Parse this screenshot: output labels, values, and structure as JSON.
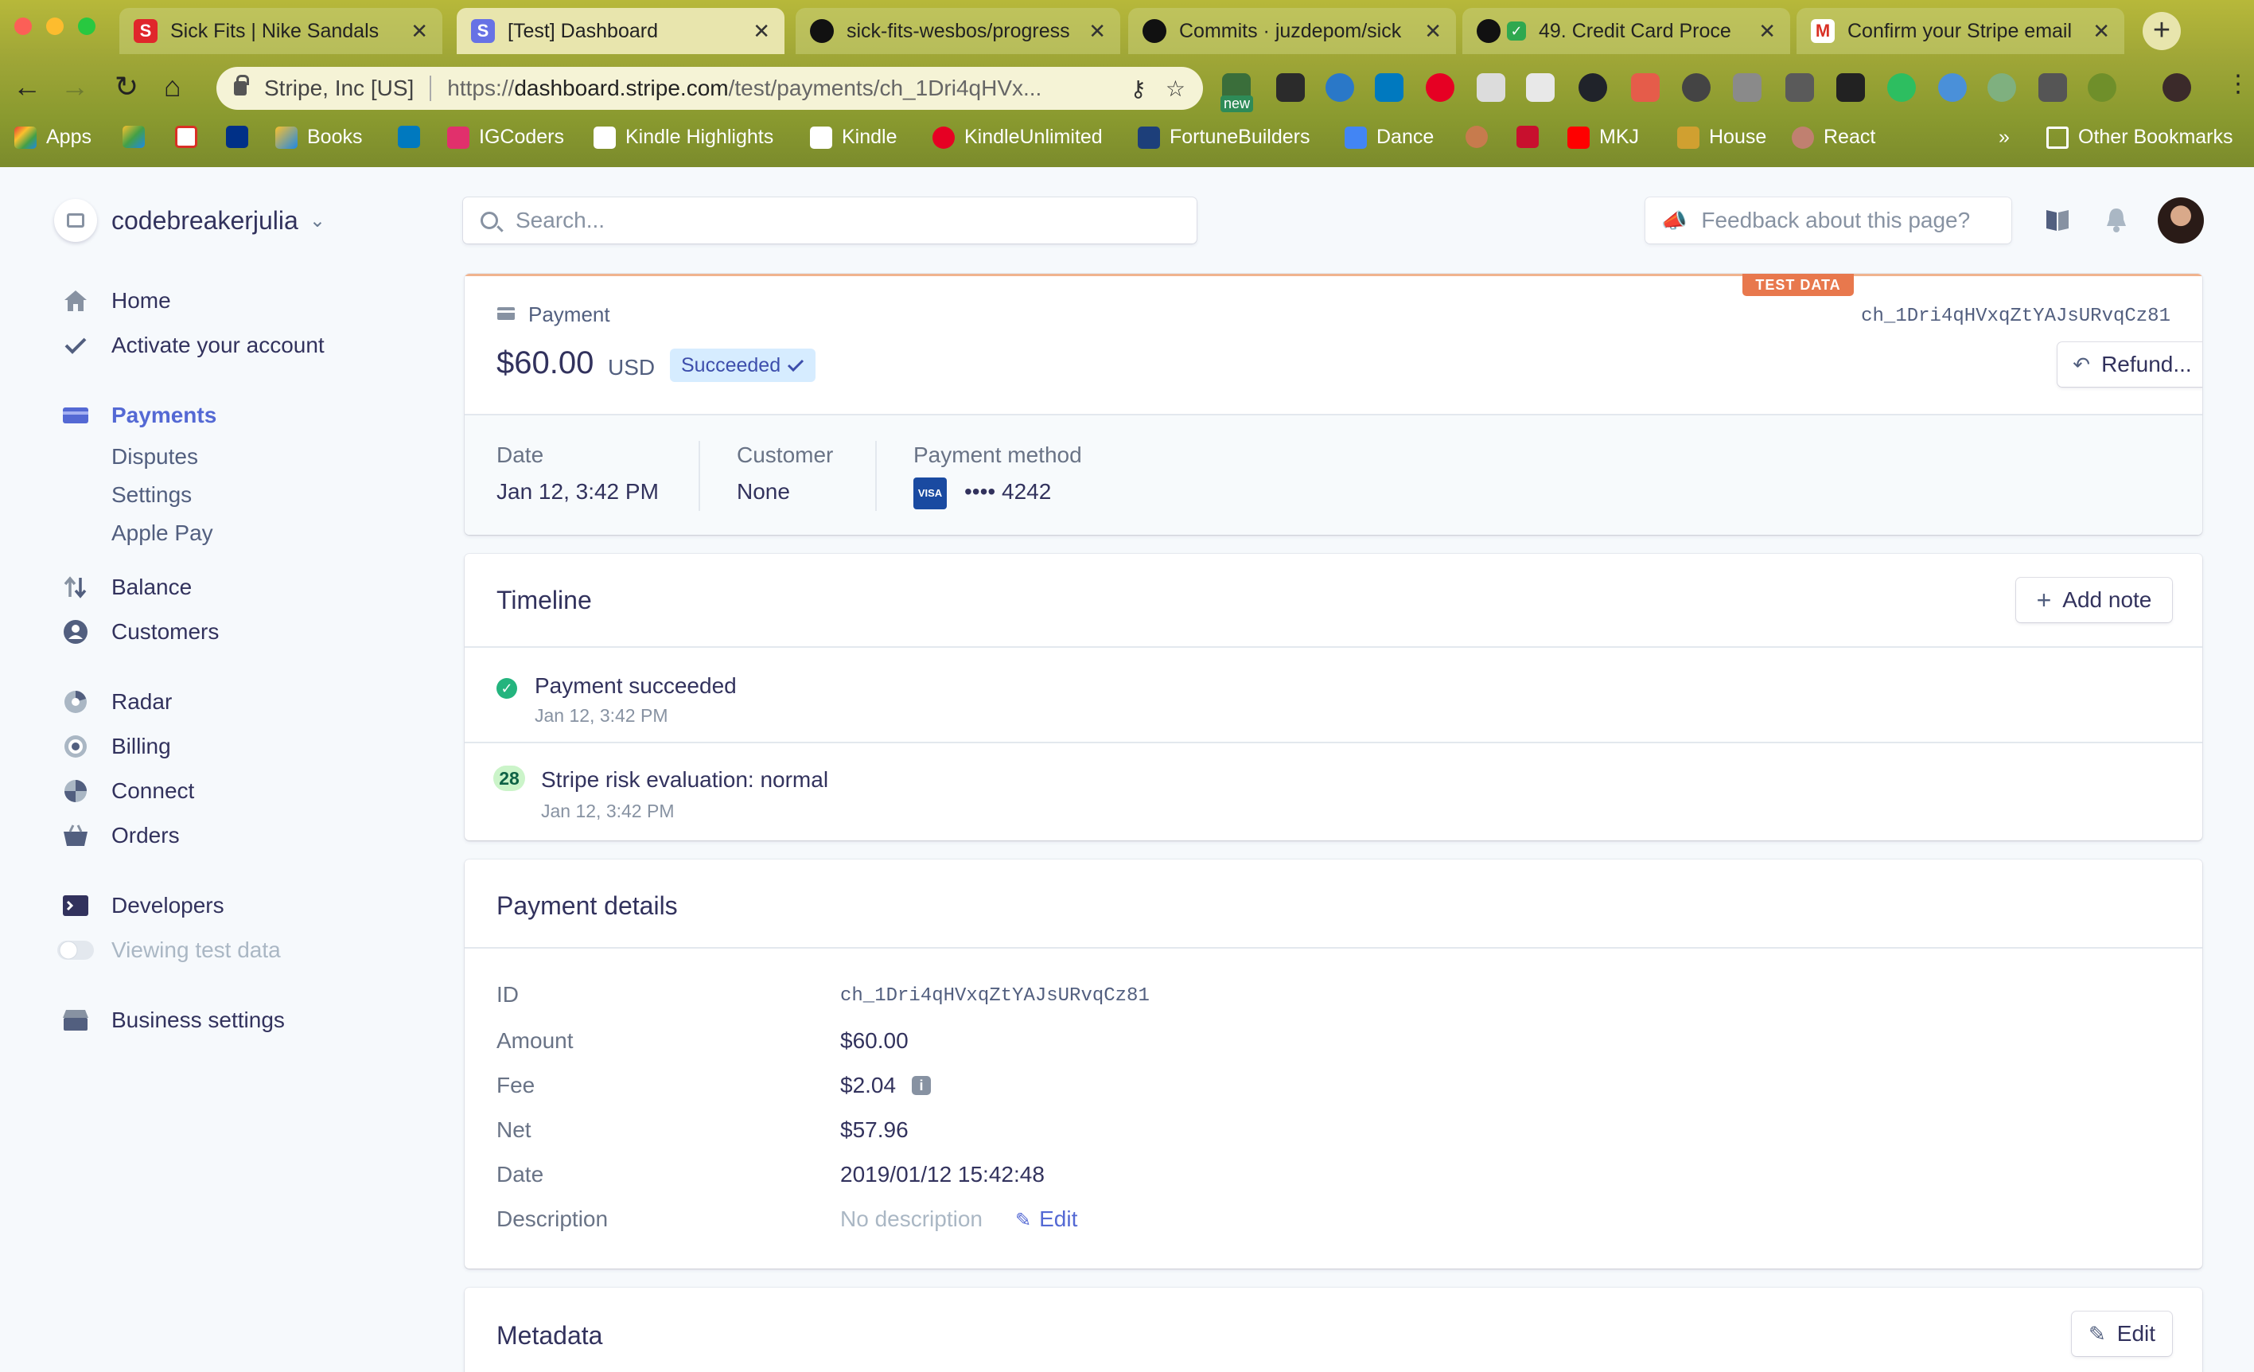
{
  "browser": {
    "tabs": [
      {
        "title": "Sick Fits | Nike Sandals",
        "favicon": "S",
        "favicon_color": "#e0262b"
      },
      {
        "title": "[Test] Dashboard",
        "favicon": "S",
        "favicon_color": "#6772e5"
      },
      {
        "title": "sick-fits-wesbos/progress",
        "favicon": "github-icon",
        "favicon_color": "#111111"
      },
      {
        "title": "Commits · juzdepom/sick",
        "favicon": "github-icon",
        "favicon_color": "#111111"
      },
      {
        "title": "49. Credit Card Proce",
        "favicon": "github-icon",
        "favicon_color": "#111111"
      },
      {
        "title": "Confirm your Stripe email",
        "favicon": "M",
        "favicon_color": "#d93025"
      }
    ],
    "active_tab": 1,
    "address": {
      "site": "Stripe, Inc [US]",
      "url_prefix": "https://",
      "url_domain": "dashboard.stripe.com",
      "url_path": "/test/payments/ch_1Dri4qHVx..."
    },
    "extension_badge": "new",
    "bookmarks": [
      "Apps",
      "Books",
      "IGCoders",
      "Kindle Highlights",
      "Kindle",
      "KindleUnlimited",
      "FortuneBuilders",
      "Dance",
      "MKJ",
      "House",
      "React"
    ],
    "bookmarks_overflow": "»",
    "other_bookmarks": "Other Bookmarks"
  },
  "sidebar": {
    "account_name": "codebreakerjulia",
    "items": [
      {
        "label": "Home",
        "icon": "home-icon"
      },
      {
        "label": "Activate your account",
        "icon": "check-icon"
      },
      {
        "label": "Payments",
        "icon": "payments-icon",
        "active": true
      },
      {
        "label": "Disputes",
        "sub": true
      },
      {
        "label": "Settings",
        "sub": true
      },
      {
        "label": "Apple Pay",
        "sub": true
      },
      {
        "label": "Balance",
        "icon": "balance-icon"
      },
      {
        "label": "Customers",
        "icon": "customers-icon"
      },
      {
        "label": "Radar",
        "icon": "radar-icon"
      },
      {
        "label": "Billing",
        "icon": "billing-icon"
      },
      {
        "label": "Connect",
        "icon": "connect-icon"
      },
      {
        "label": "Orders",
        "icon": "orders-icon"
      },
      {
        "label": "Developers",
        "icon": "developers-icon"
      },
      {
        "label": "Viewing test data",
        "icon": "toggle-icon",
        "muted": true
      },
      {
        "label": "Business settings",
        "icon": "business-settings-icon"
      }
    ]
  },
  "topbar": {
    "search_placeholder": "Search...",
    "feedback_label": "Feedback about this page?"
  },
  "payment": {
    "badge": "TEST DATA",
    "kind": "Payment",
    "charge_id": "ch_1Dri4qHVxqZtYAJsURvqCz81",
    "amount": "$60.00",
    "currency": "USD",
    "status": "Succeeded",
    "refund_label": "Refund...",
    "summary": {
      "date_label": "Date",
      "date_value": "Jan 12, 3:42 PM",
      "customer_label": "Customer",
      "customer_value": "None",
      "method_label": "Payment method",
      "card_brand": "VISA",
      "card_last4": "•••• 4242"
    }
  },
  "timeline": {
    "title": "Timeline",
    "add_note_label": "Add note",
    "events": [
      {
        "text": "Payment succeeded",
        "time": "Jan 12, 3:42 PM",
        "icon": "success-check-icon"
      },
      {
        "text": "Stripe risk evaluation: normal",
        "time": "Jan 12, 3:42 PM",
        "score": "28"
      }
    ]
  },
  "details": {
    "title": "Payment details",
    "rows": [
      {
        "label": "ID",
        "value": "ch_1Dri4qHVxqZtYAJsURvqCz81"
      },
      {
        "label": "Amount",
        "value": "$60.00"
      },
      {
        "label": "Fee",
        "value": "$2.04"
      },
      {
        "label": "Net",
        "value": "$57.96"
      },
      {
        "label": "Date",
        "value": "2019/01/12 15:42:48"
      },
      {
        "label": "Description",
        "value": "No description"
      }
    ],
    "edit_label": "Edit"
  },
  "metadata": {
    "title": "Metadata",
    "edit_label": "Edit"
  },
  "colors": {
    "accent": "#5469d4",
    "success": "#24b47e",
    "test_badge": "#e8784d",
    "status_bg": "#cbf4c9"
  }
}
